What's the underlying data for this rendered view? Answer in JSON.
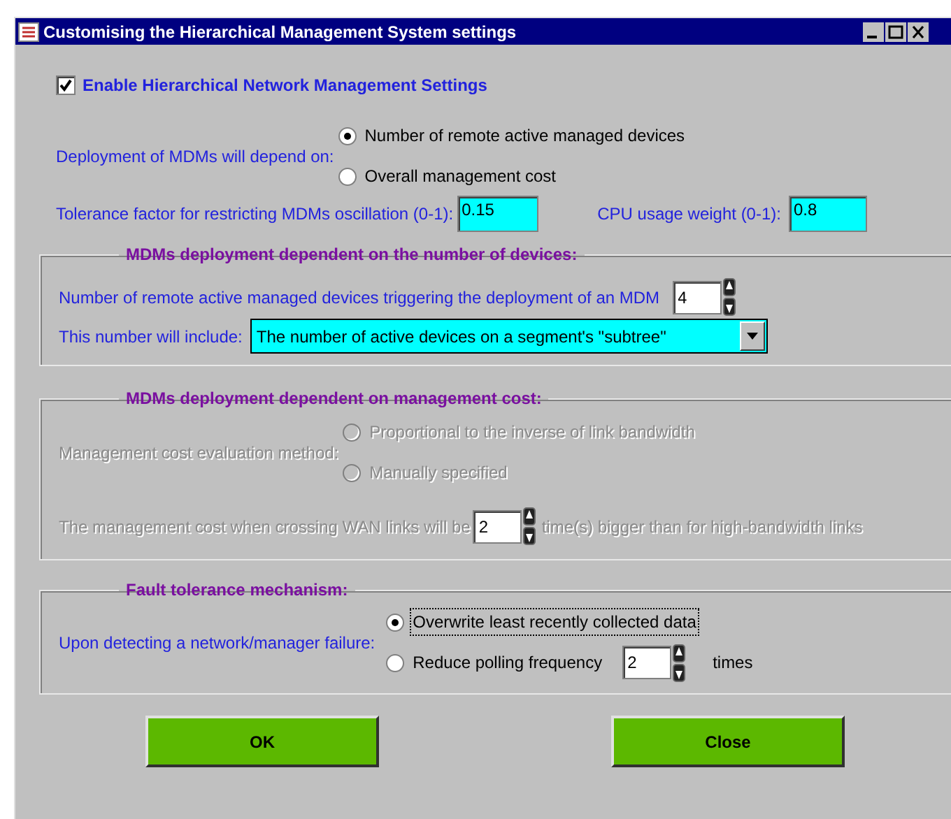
{
  "window": {
    "title": "Customising the Hierarchical Management System settings"
  },
  "enable": {
    "label": "Enable Hierarchical Network Management Settings",
    "checked": true
  },
  "deployment": {
    "label": "Deployment of MDMs will depend on:",
    "options": [
      {
        "label": "Number of remote active managed devices",
        "selected": true
      },
      {
        "label": "Overall management cost",
        "selected": false
      }
    ]
  },
  "tolerance": {
    "label": "Tolerance factor for restricting MDMs oscillation (0-1):",
    "value": "0.15"
  },
  "cpu_weight": {
    "label": "CPU usage weight (0-1):",
    "value": "0.8"
  },
  "devices_group": {
    "title": "MDMs deployment dependent on the number of devices:",
    "trigger": {
      "label": "Number of remote active managed devices triggering the deployment of an MDM",
      "value": "4"
    },
    "include": {
      "label": "This number will include:",
      "value": "The number of active devices on a segment's \"subtree\""
    }
  },
  "cost_group": {
    "title": "MDMs deployment dependent on management cost:",
    "disabled": true,
    "method": {
      "label": "Management cost evaluation method:",
      "options": [
        {
          "label": "Proportional to the inverse of link bandwidth",
          "selected": false
        },
        {
          "label": "Manually specified",
          "selected": false
        }
      ]
    },
    "wan": {
      "label": "The management cost when crossing WAN links will be",
      "value": "2",
      "suffix": "time(s) bigger than for high-bandwidth links"
    }
  },
  "fault_group": {
    "title": "Fault tolerance mechanism:",
    "label": "Upon detecting a network/manager failure:",
    "options": [
      {
        "kind": "plain",
        "label": "Overwrite least recently collected data",
        "selected": true
      },
      {
        "kind": "spinner",
        "label": "Reduce polling frequency",
        "value": "2",
        "suffix": "times",
        "selected": false
      }
    ]
  },
  "buttons": [
    "OK",
    "Close"
  ]
}
